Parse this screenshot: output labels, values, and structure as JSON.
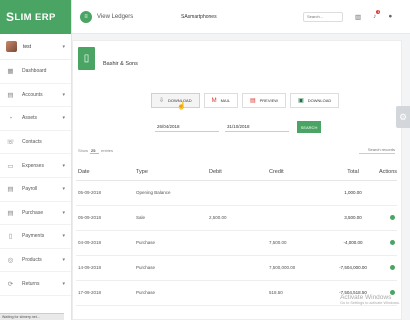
{
  "brand": {
    "first": "S",
    "rest": "LIM ERP"
  },
  "user": {
    "name": "test"
  },
  "sidebar": [
    {
      "label": "Dashboard",
      "icon": "dashboard-icon",
      "glyph": "▦",
      "caret": false
    },
    {
      "label": "Accounts",
      "icon": "accounts-icon",
      "glyph": "▤",
      "caret": true
    },
    {
      "label": "Assets",
      "icon": "assets-icon",
      "glyph": "◔",
      "caret": true
    },
    {
      "label": "Contacts",
      "icon": "contacts-icon",
      "glyph": "☏",
      "caret": false
    },
    {
      "label": "Expenses",
      "icon": "expenses-icon",
      "glyph": "▭",
      "caret": true
    },
    {
      "label": "Payroll",
      "icon": "payroll-icon",
      "glyph": "▤",
      "caret": true
    },
    {
      "label": "Purchase",
      "icon": "purchase-icon",
      "glyph": "▤",
      "caret": true
    },
    {
      "label": "Payments",
      "icon": "payments-icon",
      "glyph": "▯",
      "caret": true
    },
    {
      "label": "Products",
      "icon": "products-icon",
      "glyph": "◎",
      "caret": true
    },
    {
      "label": "Returns",
      "icon": "returns-icon",
      "glyph": "⟳",
      "caret": true
    }
  ],
  "topbar": {
    "title": "View Ledgers",
    "company": "SAsmartphones",
    "search_placeholder": "Search...",
    "notification_count": "1"
  },
  "ledger": {
    "name": "Bashir & Sons"
  },
  "actions": {
    "download": "DOWNLOAD",
    "mail": "MAIL",
    "preview": "PREVIEW",
    "download2": "DOWNLOAD"
  },
  "filters": {
    "from_date": "26/04/2018",
    "to_date": "31/10/2018",
    "search_button": "SEARCH"
  },
  "table_controls": {
    "show_label": "Show",
    "show_value": "25",
    "entries_label": "entries",
    "search_placeholder": "Search records"
  },
  "table": {
    "headers": [
      "Date",
      "Type",
      "Debit",
      "Credit",
      "Total",
      "Actions"
    ],
    "rows": [
      {
        "date": "05-09-2018",
        "type": "Opening Balance",
        "debit": "",
        "credit": "",
        "total": "1,000.00",
        "action": false
      },
      {
        "date": "05-09-2018",
        "type": "Sale",
        "debit": "2,500.00",
        "credit": "",
        "total": "3,500.00",
        "action": true
      },
      {
        "date": "04-09-2018",
        "type": "Purchase",
        "debit": "",
        "credit": "7,500.00",
        "total": "-4,000.00",
        "action": true
      },
      {
        "date": "14-09-2018",
        "type": "Purchase",
        "debit": "",
        "credit": "7,500,000.00",
        "total": "-7,504,000.00",
        "action": true
      },
      {
        "date": "17-09-2018",
        "type": "Purchase",
        "debit": "",
        "credit": "518.50",
        "total": "-7,504,518.50",
        "action": true
      }
    ]
  },
  "watermark": {
    "line1": "Activate Windows",
    "line2": "Go to Settings to activate Windows."
  },
  "status": "Waiting for slimerp.net..."
}
